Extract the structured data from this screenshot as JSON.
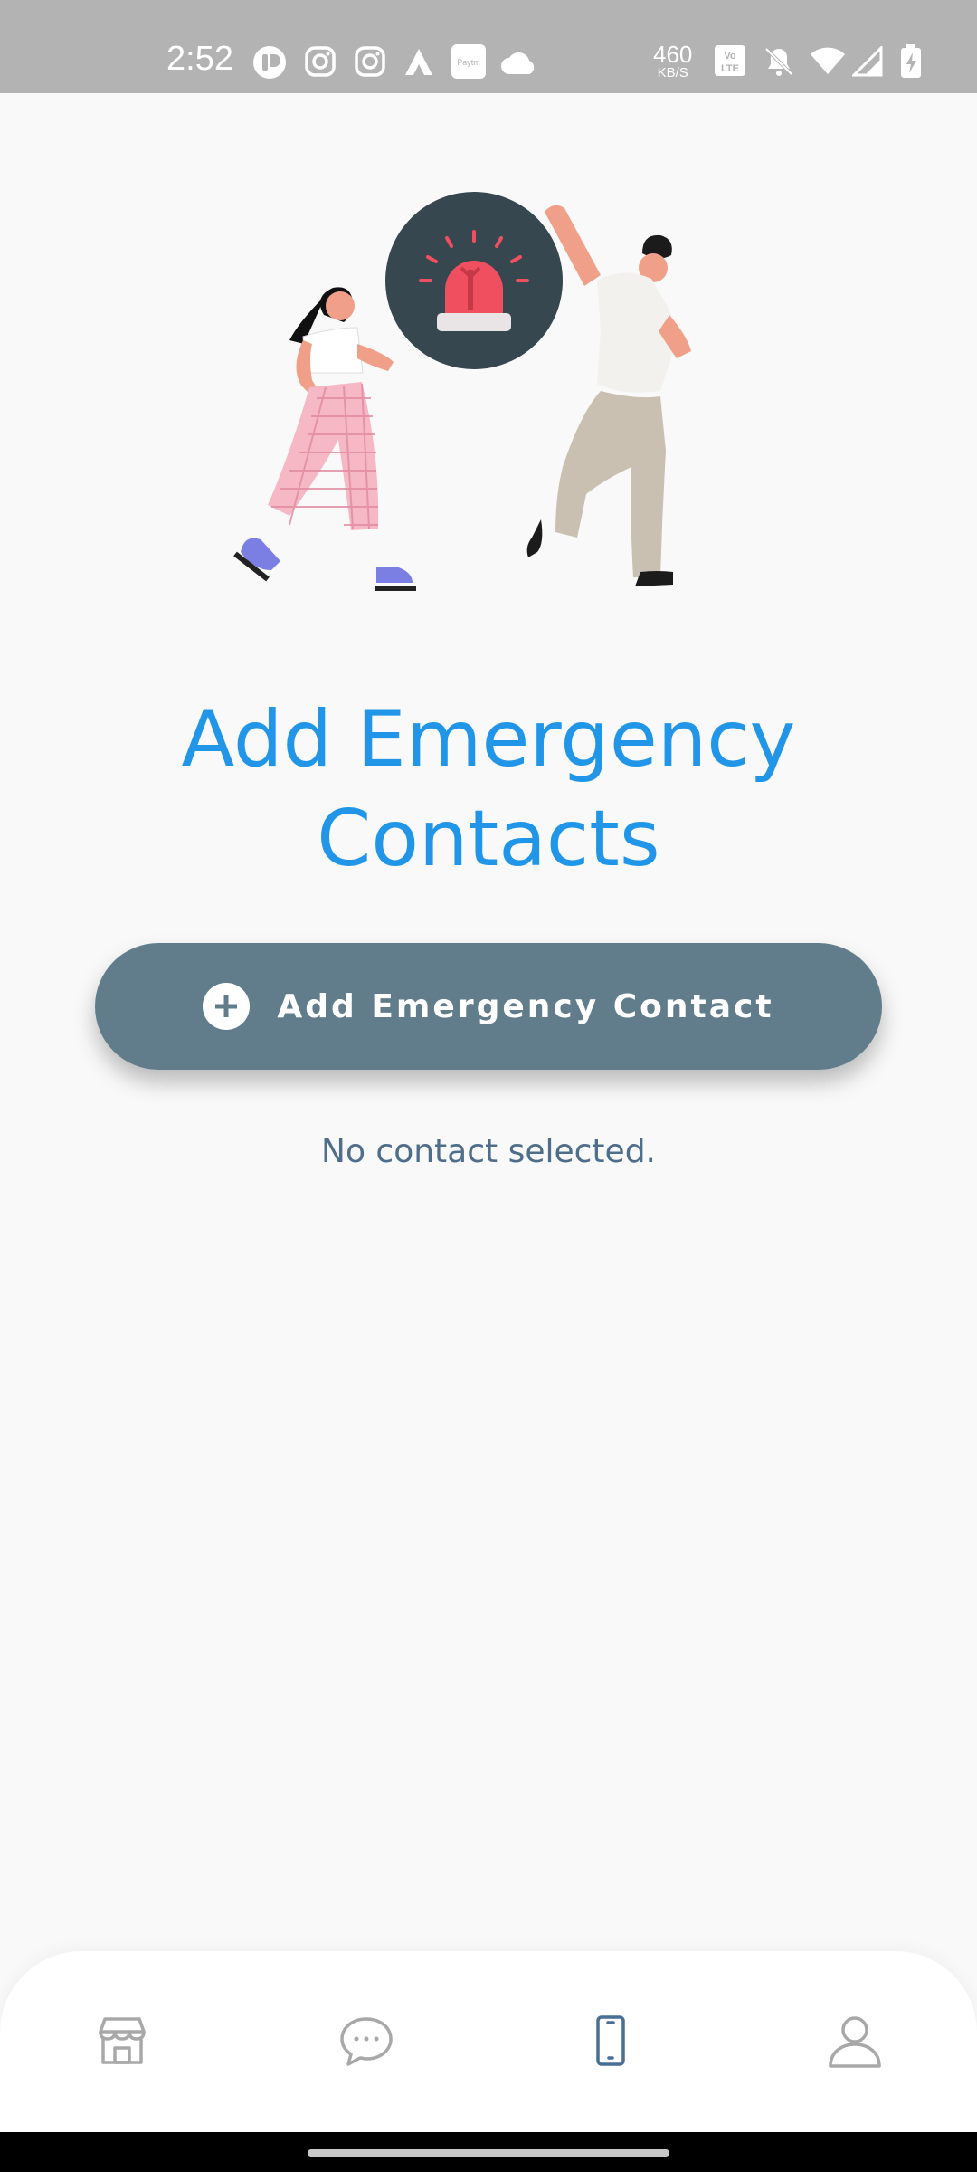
{
  "status_bar": {
    "time": "2:52",
    "net_speed_value": "460",
    "net_speed_unit": "KB/S",
    "icons": [
      "app-icon",
      "instagram-icon",
      "instagram-icon",
      "airtel-icon",
      "paytm-icon",
      "cloud-icon",
      "volte-icon",
      "mute-icon",
      "wifi-icon",
      "signal-icon",
      "battery-charging-icon"
    ],
    "paytm_label": "Paytm",
    "volte_label": "Vo LTE"
  },
  "main": {
    "title_line1": "Add Emergency",
    "title_line2": "Contacts",
    "add_button_label": "Add Emergency Contact",
    "empty_message": "No contact selected."
  },
  "bottom_nav": {
    "items": [
      {
        "icon": "store-icon",
        "active": false
      },
      {
        "icon": "chat-icon",
        "active": false
      },
      {
        "icon": "phone-icon",
        "active": true
      },
      {
        "icon": "profile-icon",
        "active": false
      }
    ]
  },
  "colors": {
    "title": "#2196e8",
    "button": "#617d8b",
    "message": "#4e6e8c",
    "nav_active": "#4a6f94",
    "nav_inactive": "#a8a8a8",
    "status_bar": "#b3b3b3"
  }
}
